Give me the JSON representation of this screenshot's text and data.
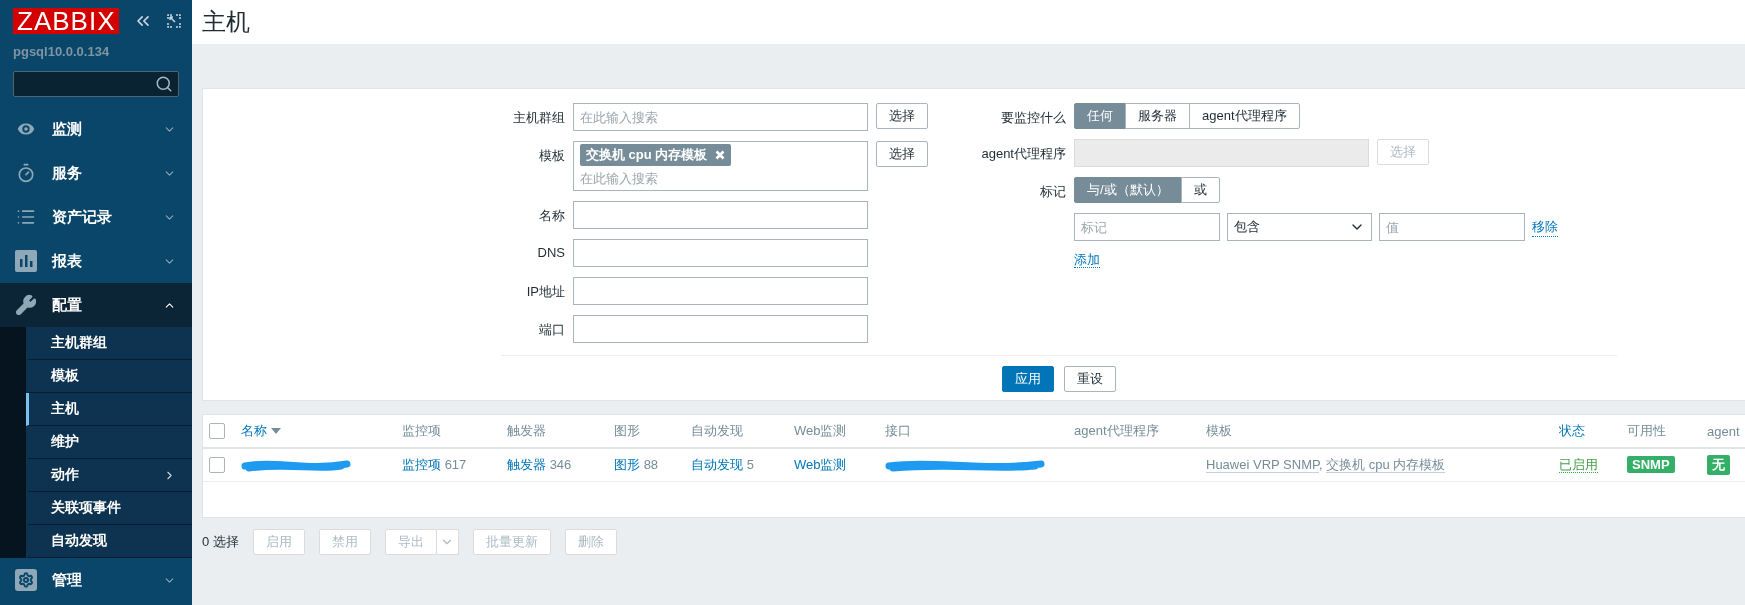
{
  "sidebar": {
    "logo": "ZABBIX",
    "server": "pgsql10.0.0.134",
    "menu": [
      {
        "label": "监测",
        "expanded": false
      },
      {
        "label": "服务",
        "expanded": false
      },
      {
        "label": "资产记录",
        "expanded": false
      },
      {
        "label": "报表",
        "expanded": false
      },
      {
        "label": "配置",
        "expanded": true,
        "children": [
          {
            "label": "主机群组",
            "selected": false,
            "submenu": false
          },
          {
            "label": "模板",
            "selected": false,
            "submenu": false
          },
          {
            "label": "主机",
            "selected": true,
            "submenu": false
          },
          {
            "label": "维护",
            "selected": false,
            "submenu": false
          },
          {
            "label": "动作",
            "selected": false,
            "submenu": true
          },
          {
            "label": "关联项事件",
            "selected": false,
            "submenu": false
          },
          {
            "label": "自动发现",
            "selected": false,
            "submenu": false
          }
        ]
      },
      {
        "label": "管理",
        "expanded": false
      }
    ]
  },
  "page_title": "主机",
  "filter": {
    "left": [
      {
        "label": "主机群组",
        "kind": "multiselect",
        "placeholder": "在此输入搜索",
        "button": "选择"
      },
      {
        "label": "模板",
        "kind": "multiselect",
        "tags": [
          "交换机 cpu 内存模板"
        ],
        "placeholder": "在此输入搜索",
        "button": "选择"
      },
      {
        "label": "名称",
        "kind": "text"
      },
      {
        "label": "DNS",
        "kind": "text"
      },
      {
        "label": "IP地址",
        "kind": "text"
      },
      {
        "label": "端口",
        "kind": "text"
      }
    ],
    "monitored_by": {
      "label": "要监控什么",
      "options": [
        {
          "label": "任何",
          "selected": true
        },
        {
          "label": "服务器",
          "selected": false
        },
        {
          "label": "agent代理程序",
          "selected": false
        }
      ]
    },
    "proxy": {
      "label": "agent代理程序",
      "disabled": true,
      "button": "选择"
    },
    "tags": {
      "label": "标记",
      "operators": [
        {
          "label": "与/或（默认）",
          "selected": true
        },
        {
          "label": "或",
          "selected": false
        }
      ],
      "rows": [
        {
          "tag_placeholder": "标记",
          "operator": "包含",
          "value_placeholder": "值",
          "remove": "移除"
        }
      ],
      "add": "添加"
    },
    "apply": "应用",
    "reset": "重设"
  },
  "table": {
    "all_checked": false,
    "columns": [
      {
        "label": "名称",
        "sortable": true,
        "sorted": true
      },
      {
        "label": "监控项",
        "sortable": false
      },
      {
        "label": "触发器",
        "sortable": false
      },
      {
        "label": "图形",
        "sortable": false
      },
      {
        "label": "自动发现",
        "sortable": false
      },
      {
        "label": "Web监测",
        "sortable": false
      },
      {
        "label": "接口",
        "sortable": false
      },
      {
        "label": "agent代理程序",
        "sortable": false
      },
      {
        "label": "模板",
        "sortable": false
      },
      {
        "label": "状态",
        "sortable": true,
        "sorted": false
      },
      {
        "label": "可用性",
        "sortable": false
      },
      {
        "label": "agent",
        "sortable": false
      }
    ],
    "rows": [
      {
        "checked": false,
        "name_redacted": true,
        "links": [
          {
            "label": "监控项",
            "count": "617"
          },
          {
            "label": "触发器",
            "count": "346"
          },
          {
            "label": "图形",
            "count": "88"
          },
          {
            "label": "自动发现",
            "count": "5"
          },
          {
            "label": "Web监测"
          }
        ],
        "interface_redacted": true,
        "templates": [
          {
            "label": "Huawei VRP SNMP",
            "separator": ","
          },
          {
            "label": "交换机 cpu 内存模板"
          }
        ],
        "status": {
          "label": "已启用",
          "enabled": true
        },
        "availability": [
          {
            "label": "SNMP",
            "available": true
          }
        ],
        "agent": {
          "label": "无",
          "available": true
        }
      }
    ]
  },
  "footer": {
    "selected": "0 选择",
    "buttons": [
      {
        "label": "启用",
        "disabled": true,
        "dropdown": false
      },
      {
        "label": "禁用",
        "disabled": true,
        "dropdown": false
      },
      {
        "label": "导出",
        "disabled": true,
        "dropdown": true
      },
      {
        "label": "批量更新",
        "disabled": true,
        "dropdown": false
      },
      {
        "label": "删除",
        "disabled": true,
        "dropdown": false
      }
    ]
  }
}
